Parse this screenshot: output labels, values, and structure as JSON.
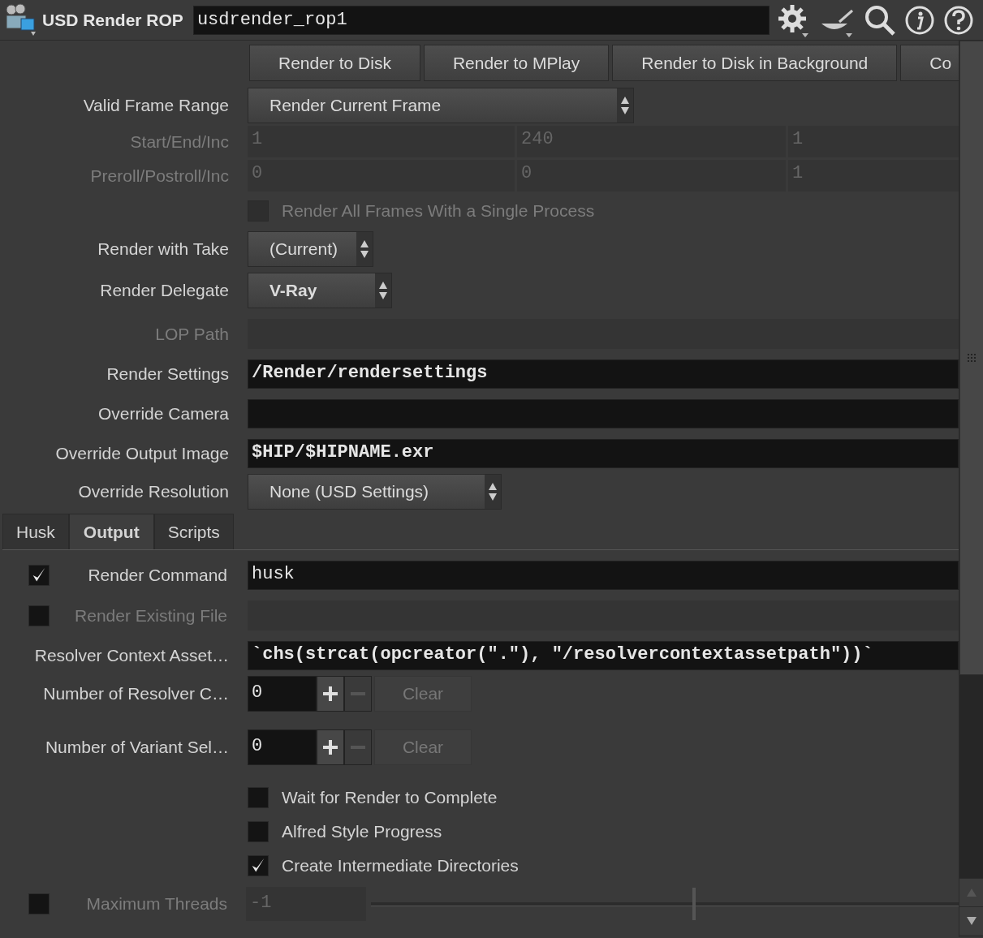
{
  "header": {
    "node_type": "USD Render ROP",
    "node_name": "usdrender_rop1"
  },
  "actions": [
    "Render to Disk",
    "Render to MPlay",
    "Render to Disk in Background",
    "Co"
  ],
  "parameters": [
    {
      "kind": "menu",
      "label": "Valid Frame Range",
      "value": "Render Current Frame",
      "changed": false,
      "disabled": false
    },
    {
      "kind": "triple",
      "label": "Start/End/Inc",
      "values": [
        "1",
        "240",
        "1"
      ],
      "disabled": true
    },
    {
      "kind": "triple",
      "label": "Preroll/Postroll/Inc",
      "values": [
        "0",
        "0",
        "1"
      ],
      "disabled": true
    },
    {
      "kind": "check",
      "label": "Render All Frames With a Single Process",
      "checked": false,
      "disabled": true
    },
    {
      "kind": "menu",
      "label": "Render with Take",
      "value": "(Current)",
      "changed": false,
      "disabled": false
    },
    {
      "kind": "menu",
      "label": "Render Delegate",
      "value": "V-Ray",
      "changed": true,
      "disabled": false
    },
    {
      "kind": "string",
      "label": "LOP Path",
      "disabled": true
    },
    {
      "kind": "string",
      "label": "Render Settings",
      "value": "/Render/rendersettings",
      "changed": true,
      "disabled": false
    },
    {
      "kind": "string",
      "label": "Override Camera",
      "disabled": false
    },
    {
      "kind": "string",
      "label": "Override Output Image",
      "value": "$HIP/$HIPNAME.exr",
      "changed": true,
      "disabled": false
    },
    {
      "kind": "menu",
      "label": "Override Resolution",
      "value": "None (USD Settings)",
      "changed": false,
      "disabled": false
    }
  ],
  "tabs": [
    {
      "label": "Husk",
      "selected": false
    },
    {
      "label": "Output",
      "selected": true
    },
    {
      "label": "Scripts",
      "selected": false
    }
  ],
  "tab_parameters": [
    {
      "kind": "string",
      "label": "Render Command",
      "toggle_checked": true,
      "value": "husk",
      "changed": false,
      "disabled": false
    },
    {
      "kind": "string",
      "label": "Render Existing File",
      "toggle_checked": false,
      "disabled": true
    },
    {
      "kind": "string",
      "label": "Resolver Context Asset…",
      "value": "`chs(strcat(opcreator(\".\"), \"/resolvercontextassetpath\"))`",
      "changed": true,
      "disabled": false
    },
    {
      "kind": "multiparm",
      "label": "Number of Resolver C…",
      "value": "0",
      "clear": "Clear",
      "empty": true
    },
    {
      "kind": "multiparm",
      "label": "Number of Variant Sel…",
      "value": "0",
      "clear": "Clear",
      "empty": true
    },
    {
      "kind": "check",
      "label": "Wait for Render to Complete",
      "checked": false,
      "disabled": false
    },
    {
      "kind": "check",
      "label": "Alfred Style Progress",
      "checked": false,
      "disabled": false
    },
    {
      "kind": "check",
      "label": "Create Intermediate Directories",
      "checked": true,
      "disabled": false
    },
    {
      "kind": "slider",
      "label": "Maximum Threads",
      "toggle_checked": false,
      "value": "-1",
      "level": 0.55,
      "disabled": true
    }
  ]
}
